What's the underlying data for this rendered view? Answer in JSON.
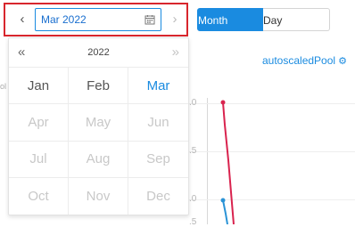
{
  "toolbar": {
    "picker_value": "Mar 2022",
    "buttons": {
      "month": "Month",
      "day": "Day"
    }
  },
  "chart_panel": {
    "link_label": "autoscaledPool",
    "left_text_fragment": "ol",
    "axis_labels": [
      ".0",
      ".5",
      ".0",
      ".5"
    ],
    "colors": {
      "line_red": "#d9234e",
      "line_blue": "#2a93d6"
    }
  },
  "month_picker": {
    "year": "2022",
    "months": [
      {
        "label": "Jan",
        "state": "enabled"
      },
      {
        "label": "Feb",
        "state": "enabled"
      },
      {
        "label": "Mar",
        "state": "selected"
      },
      {
        "label": "Apr",
        "state": "disabled"
      },
      {
        "label": "May",
        "state": "disabled"
      },
      {
        "label": "Jun",
        "state": "disabled"
      },
      {
        "label": "Jul",
        "state": "disabled"
      },
      {
        "label": "Aug",
        "state": "disabled"
      },
      {
        "label": "Sep",
        "state": "disabled"
      },
      {
        "label": "Oct",
        "state": "disabled"
      },
      {
        "label": "Nov",
        "state": "disabled"
      },
      {
        "label": "Dec",
        "state": "disabled"
      }
    ]
  },
  "colors": {
    "accent": "#1a8be0",
    "highlight": "#d8262d"
  },
  "icons": [
    "chevron-left-icon",
    "chevron-right-icon",
    "calendar-icon",
    "double-chevron-left-icon",
    "double-chevron-right-icon",
    "gear-icon"
  ]
}
